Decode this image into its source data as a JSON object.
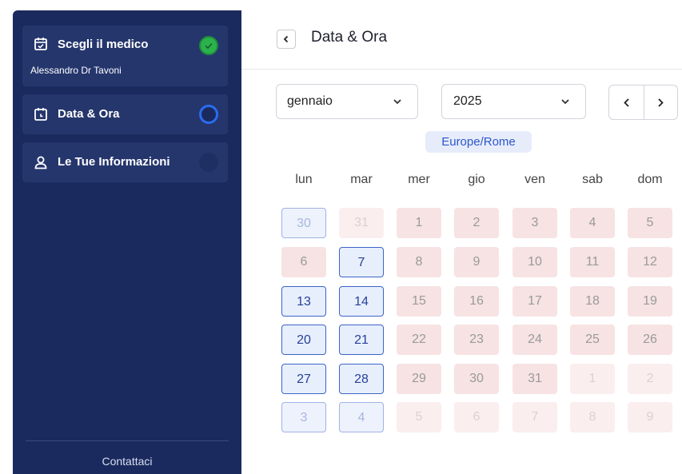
{
  "sidebar": {
    "steps": [
      {
        "title": "Scegli il medico",
        "subtitle": "Alessandro Dr Tavoni",
        "icon": "calendar-check-icon",
        "status": "completed"
      },
      {
        "title": "Data & Ora",
        "icon": "calendar-clock-icon",
        "status": "current"
      },
      {
        "title": "Le Tue Informazioni",
        "icon": "user-icon",
        "status": "pending"
      }
    ],
    "contact_label": "Contattaci"
  },
  "header": {
    "title": "Data & Ora",
    "back_icon": "chevron-left-icon"
  },
  "filters": {
    "month": "gennaio",
    "year": "2025",
    "prev_icon": "chevron-left-icon",
    "next_icon": "chevron-right-icon"
  },
  "timezone": "Europe/Rome",
  "calendar": {
    "weekdays": [
      "lun",
      "mar",
      "mer",
      "gio",
      "ven",
      "sab",
      "dom"
    ],
    "weeks": [
      [
        {
          "d": "30",
          "s": "avail-out"
        },
        {
          "d": "31",
          "s": "unavail-out"
        },
        {
          "d": "1",
          "s": "unavail"
        },
        {
          "d": "2",
          "s": "unavail"
        },
        {
          "d": "3",
          "s": "unavail"
        },
        {
          "d": "4",
          "s": "unavail"
        },
        {
          "d": "5",
          "s": "unavail"
        }
      ],
      [
        {
          "d": "6",
          "s": "unavail"
        },
        {
          "d": "7",
          "s": "avail"
        },
        {
          "d": "8",
          "s": "unavail"
        },
        {
          "d": "9",
          "s": "unavail"
        },
        {
          "d": "10",
          "s": "unavail"
        },
        {
          "d": "11",
          "s": "unavail"
        },
        {
          "d": "12",
          "s": "unavail"
        }
      ],
      [
        {
          "d": "13",
          "s": "avail"
        },
        {
          "d": "14",
          "s": "avail"
        },
        {
          "d": "15",
          "s": "unavail"
        },
        {
          "d": "16",
          "s": "unavail"
        },
        {
          "d": "17",
          "s": "unavail"
        },
        {
          "d": "18",
          "s": "unavail"
        },
        {
          "d": "19",
          "s": "unavail"
        }
      ],
      [
        {
          "d": "20",
          "s": "avail"
        },
        {
          "d": "21",
          "s": "avail"
        },
        {
          "d": "22",
          "s": "unavail"
        },
        {
          "d": "23",
          "s": "unavail"
        },
        {
          "d": "24",
          "s": "unavail"
        },
        {
          "d": "25",
          "s": "unavail"
        },
        {
          "d": "26",
          "s": "unavail"
        }
      ],
      [
        {
          "d": "27",
          "s": "avail"
        },
        {
          "d": "28",
          "s": "avail"
        },
        {
          "d": "29",
          "s": "unavail"
        },
        {
          "d": "30",
          "s": "unavail"
        },
        {
          "d": "31",
          "s": "unavail"
        },
        {
          "d": "1",
          "s": "unavail-out"
        },
        {
          "d": "2",
          "s": "unavail-out"
        }
      ],
      [
        {
          "d": "3",
          "s": "avail-out"
        },
        {
          "d": "4",
          "s": "avail-out"
        },
        {
          "d": "5",
          "s": "unavail-out"
        },
        {
          "d": "6",
          "s": "unavail-out"
        },
        {
          "d": "7",
          "s": "unavail-out"
        },
        {
          "d": "8",
          "s": "unavail-out"
        },
        {
          "d": "9",
          "s": "unavail-out"
        }
      ]
    ]
  },
  "colors": {
    "sidebar_bg": "#1a2a5e",
    "step_bg": "#25366d",
    "accent": "#2a6cf0",
    "completed": "#2bb24c",
    "available_border": "#3b63c8",
    "unavailable_bg": "#f7e3e3"
  }
}
